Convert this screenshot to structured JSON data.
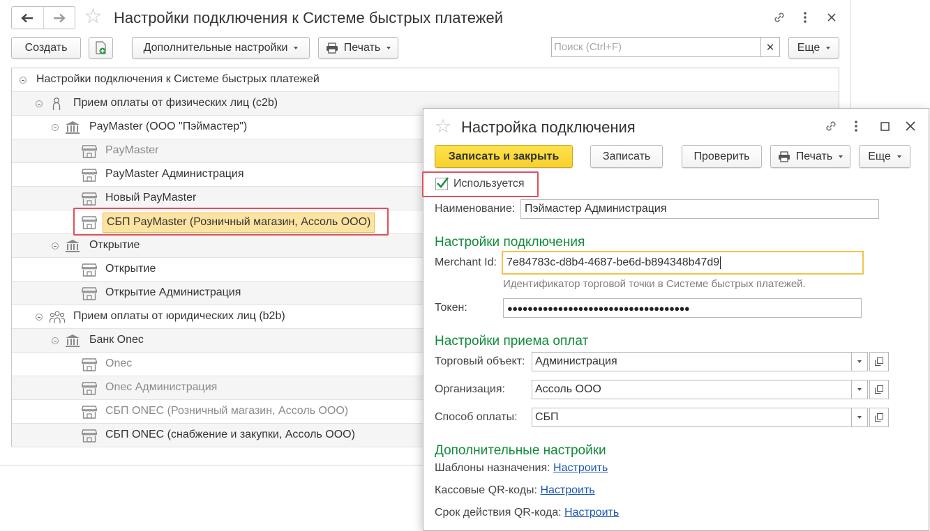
{
  "main": {
    "title": "Настройки подключения к Системе быстрых платежей",
    "toolbar": {
      "create": "Создать",
      "additional": "Дополнительные настройки",
      "print": "Печать",
      "search_placeholder": "Поиск (Ctrl+F)",
      "more": "Еще"
    },
    "tree": [
      {
        "label": "Настройки подключения к Системе быстрых платежей",
        "level": 0,
        "icon": "none",
        "expanded": true
      },
      {
        "label": "Прием оплаты от физических лиц (c2b)",
        "level": 1,
        "icon": "person-icon",
        "expanded": true
      },
      {
        "label": "PayMaster (ООО \"Пэймастер\")",
        "level": 2,
        "icon": "bank-icon",
        "expanded": true
      },
      {
        "label": "PayMaster",
        "level": 3,
        "icon": "shop-icon",
        "grey": true
      },
      {
        "label": "PayMaster Администрация",
        "level": 3,
        "icon": "shop-icon"
      },
      {
        "label": "Новый PayMaster",
        "level": 3,
        "icon": "shop-icon"
      },
      {
        "label": "СБП PayMaster (Розничный магазин, Ассоль ООО)",
        "level": 3,
        "icon": "shop-icon",
        "selected": true
      },
      {
        "label": "Открытие",
        "level": 2,
        "icon": "bank-icon",
        "expanded": true
      },
      {
        "label": "Открытие",
        "level": 3,
        "icon": "shop-icon"
      },
      {
        "label": "Открытие Администрация",
        "level": 3,
        "icon": "shop-icon"
      },
      {
        "label": "Прием оплаты от юридических лиц (b2b)",
        "level": 1,
        "icon": "people-icon",
        "expanded": true
      },
      {
        "label": "Банк Onec",
        "level": 2,
        "icon": "bank-icon",
        "expanded": true
      },
      {
        "label": "Onec",
        "level": 3,
        "icon": "shop-icon",
        "grey": true
      },
      {
        "label": "Onec Администрация",
        "level": 3,
        "icon": "shop-icon",
        "grey": true
      },
      {
        "label": "СБП ONEC (Розничный магазин, Ассоль ООО)",
        "level": 3,
        "icon": "shop-icon",
        "grey": true
      },
      {
        "label": "СБП ONEC (снабжение и закупки, Ассоль ООО)",
        "level": 3,
        "icon": "shop-icon"
      }
    ]
  },
  "dialog": {
    "title": "Настройка подключения",
    "buttons": {
      "save_close": "Записать и закрыть",
      "save": "Записать",
      "check": "Проверить",
      "print": "Печать",
      "more": "Еще"
    },
    "used_label": "Используется",
    "used_checked": true,
    "name_label": "Наименование:",
    "name_value": "Пэймастер Администрация",
    "section_connection": "Настройки подключения",
    "merchant_label": "Merchant Id:",
    "merchant_value": "7e84783c-d8b4-4687-be6d-b894348b47d9",
    "merchant_hint": "Идентификатор торговой точки в Системе быстрых платежей.",
    "token_label": "Токен:",
    "token_value": "●●●●●●●●●●●●●●●●●●●●●●●●●●●●●●●●●●●●",
    "section_payments": "Настройки приема оплат",
    "trade_label": "Торговый объект:",
    "trade_value": "Администрация",
    "org_label": "Организация:",
    "org_value": "Ассоль ООО",
    "method_label": "Способ оплаты:",
    "method_value": "СБП",
    "section_additional": "Дополнительные настройки",
    "templates_label": "Шаблоны назначения:",
    "qr_label": "Кассовые QR-коды:",
    "qr_term_label": "Срок действия QR-кода:",
    "configure_link": "Настроить"
  },
  "colors": {
    "section_green": "#138a3c",
    "highlight_red": "#e0505a",
    "selection_yellow": "#fde3a0",
    "primary_button": "#f7d12e",
    "link_blue": "#1c56b3"
  }
}
